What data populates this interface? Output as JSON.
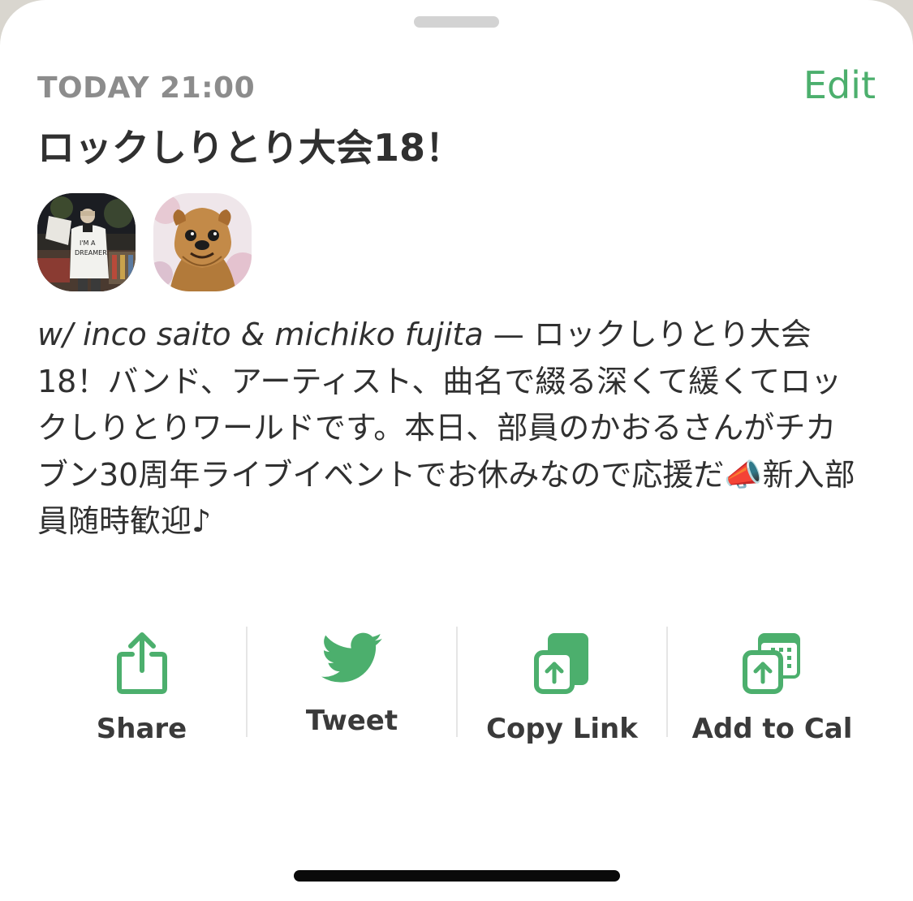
{
  "event": {
    "time_label": "TODAY 21:00",
    "edit_label": "Edit",
    "title": "ロックしりとり大会18！",
    "hosts_text": "w/ inco saito & michiko fujita",
    "separator": " — ",
    "description": "ロックしりとり大会18！バンド、アーティスト、曲名で綴る深くて緩くてロックしりとりワールドです。本日、部員のかおるさんがチカブン30周年ライブイベントでお休みなので応援だ📣新入部員随時歓迎♪"
  },
  "avatars": [
    {
      "name": "inco saito",
      "icon": "person-photo"
    },
    {
      "name": "michiko fujita",
      "icon": "dog-photo"
    }
  ],
  "actions": {
    "share": {
      "label": "Share",
      "icon": "share-icon"
    },
    "tweet": {
      "label": "Tweet",
      "icon": "twitter-bird-icon"
    },
    "copy_link": {
      "label": "Copy Link",
      "icon": "copy-link-icon"
    },
    "add_to_cal": {
      "label": "Add to Cal",
      "icon": "calendar-add-icon"
    }
  },
  "colors": {
    "accent": "#4caf6d",
    "text": "#303030",
    "muted": "#8c8c8c"
  }
}
